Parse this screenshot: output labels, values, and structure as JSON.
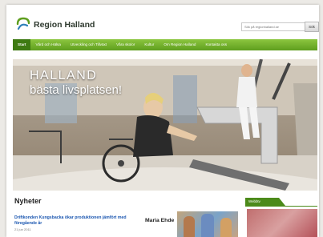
{
  "header": {
    "site_title": "Region Halland",
    "search_placeholder": "Sök på regionhalland.se",
    "search_button": "Sök"
  },
  "nav": {
    "items": [
      {
        "label": "Start",
        "active": true
      },
      {
        "label": "Vård och Hälsa"
      },
      {
        "label": "Utveckling och Tillväxt"
      },
      {
        "label": "Våra skolor"
      },
      {
        "label": "Kultur"
      },
      {
        "label": "Om Region Halland"
      },
      {
        "label": "Kontakta oss"
      }
    ]
  },
  "hero": {
    "caption_line1": "HALLAND",
    "caption_line2": "bästa livsplatsen!"
  },
  "news": {
    "title": "Nyheter",
    "item_title": "Driftkonden Kungsbacka ökar produktionen jämfört med föregående år",
    "item_date": "21 jun 2011"
  },
  "profile": {
    "name": "Maria Ehde"
  },
  "sidebar": {
    "tab_label": "Webbtv"
  },
  "colors": {
    "nav_green": "#6aa82a",
    "nav_active": "#3e7a12",
    "link_blue": "#1a56b0"
  }
}
